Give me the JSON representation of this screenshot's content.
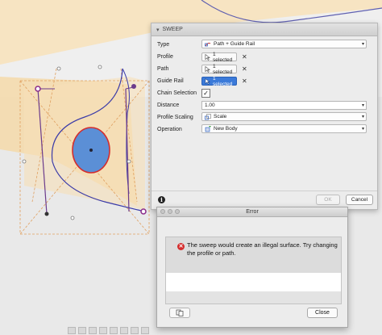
{
  "colors": {
    "canvas_bg": "#efefef",
    "surface_tan": "#f7e4c2",
    "sweep_profile_fill": "#5b8fd6",
    "profile_outline": "#d42c2c",
    "path_purple": "#6b3b8c",
    "guide_rail": "#3b3ba8",
    "selected_blue": "#3b7ad9"
  },
  "sweep_dialog": {
    "title": "SWEEP",
    "rows": {
      "type": {
        "label": "Type",
        "value": "Path + Guide Rail",
        "icon": "path-guide-rail-icon"
      },
      "profile": {
        "label": "Profile",
        "value": "1 selected",
        "icon": "select-cursor-icon"
      },
      "path": {
        "label": "Path",
        "value": "1 selected",
        "icon": "select-cursor-icon"
      },
      "guide_rail": {
        "label": "Guide Rail",
        "value": "1 selected",
        "icon": "select-cursor-icon"
      },
      "chain_selection": {
        "label": "Chain Selection",
        "checked": true,
        "check_glyph": "✓"
      },
      "distance": {
        "label": "Distance",
        "value": "1.00"
      },
      "profile_scaling": {
        "label": "Profile Scaling",
        "value": "Scale",
        "icon": "scale-icon"
      },
      "operation": {
        "label": "Operation",
        "value": "New Body",
        "icon": "new-body-icon"
      }
    },
    "clear_glyph": "✕",
    "info_glyph": "i",
    "ok_label": "OK",
    "cancel_label": "Cancel"
  },
  "error_dialog": {
    "title": "Error",
    "message": "The sweep would create an illegal surface. Try changing the profile or path.",
    "close_label": "Close",
    "copy_icon": "copy-icon"
  }
}
